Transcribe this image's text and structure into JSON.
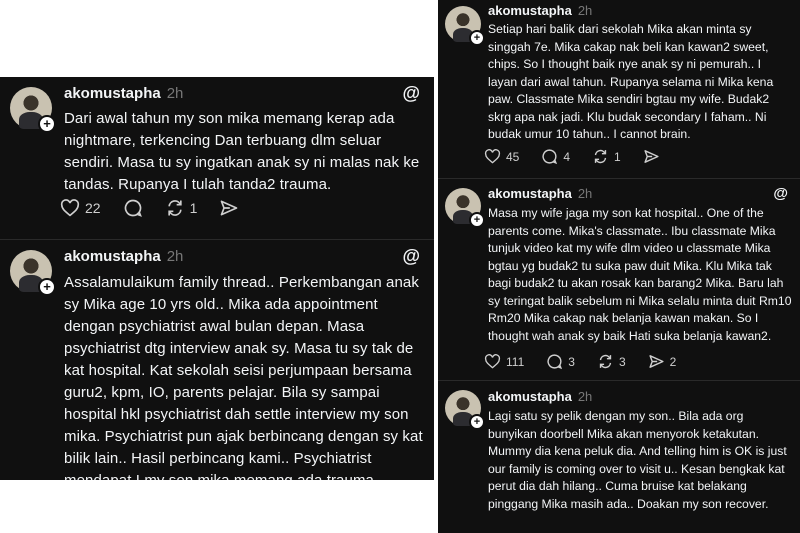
{
  "left_posts": [
    {
      "username": "akomustapha",
      "time": "2h",
      "text": "Dari awal tahun my son mika memang kerap ada nightmare, terkencing Dan terbuang dlm seluar sendiri. Masa tu sy ingatkan anak sy ni malas nak ke tandas. Rupanya I tulah tanda2 trauma.",
      "likes": "22",
      "replies": "",
      "reposts": "1"
    },
    {
      "username": "akomustapha",
      "time": "2h",
      "text": "Assalamulaikum family thread.. Perkembangan anak sy Mika age 10 yrs old.. Mika ada appointment dengan psychiatrist awal bulan depan. Masa psychiatrist dtg interview anak sy. Masa tu sy tak de kat hospital. Kat sekolah seisi perjumpaan bersama guru2, kpm, IO, parents pelajar. Bila sy sampai hospital hkl psychiatrist dah settle interview my son mika. Psychiatrist pun ajak berbincang dengan sy kat bilik lain.. Hasil perbincang kami.. Psychiatrist mendapat I my son mika memang ada trauma."
    }
  ],
  "right_posts": [
    {
      "username": "akomustapha",
      "time": "2h",
      "text": "Setiap hari balik dari sekolah Mika akan minta sy singgah 7e. Mika cakap nak beli kan kawan2 sweet, chips. So I thought baik nye anak sy ni pemurah.. I layan dari awal tahun. Rupanya selama ni Mika kena paw. Classmate Mika sendiri bgtau my wife. Budak2 skrg apa nak jadi. Klu budak secondary I faham.. Ni budak umur 10 tahun.. I cannot brain.",
      "likes": "45",
      "replies": "4",
      "reposts": "1"
    },
    {
      "username": "akomustapha",
      "time": "2h",
      "text": "Masa my wife jaga my son kat hospital.. One of the parents come. Mika's classmate.. Ibu classmate Mika tunjuk video kat my wife dlm video u classmate Mika bgtau yg budak2 tu suka paw duit Mika. Klu Mika tak bagi budak2 tu akan rosak kan barang2 Mika. Baru lah sy teringat balik sebelum ni Mika selalu minta duit Rm10 Rm20 Mika cakap nak belanja kawan makan. So I thought wah anak sy baik Hati suka belanja kawan2.",
      "likes": "111",
      "replies": "3",
      "reposts": "3",
      "shares": "2"
    },
    {
      "username": "akomustapha",
      "time": "2h",
      "text": "Lagi satu sy pelik dengan my son.. Bila ada org bunyikan doorbell Mika akan menyorok ketakutan. Mummy dia kena peluk dia. And telling him is OK is just our family is coming over to visit u.. Kesan bengkak kat perut dia dah hilang.. Cuma bruise kat belakang pinggang Mika masih ada.. Doakan my son recover."
    }
  ],
  "icons": {
    "threads": "threads-logo-icon",
    "like": "heart-icon",
    "reply": "comment-bubble-icon",
    "repost": "repost-icon",
    "share": "send-icon"
  },
  "colors": {
    "panel_bg": "#101010",
    "text": "#f3f5f7",
    "muted": "#777777"
  }
}
